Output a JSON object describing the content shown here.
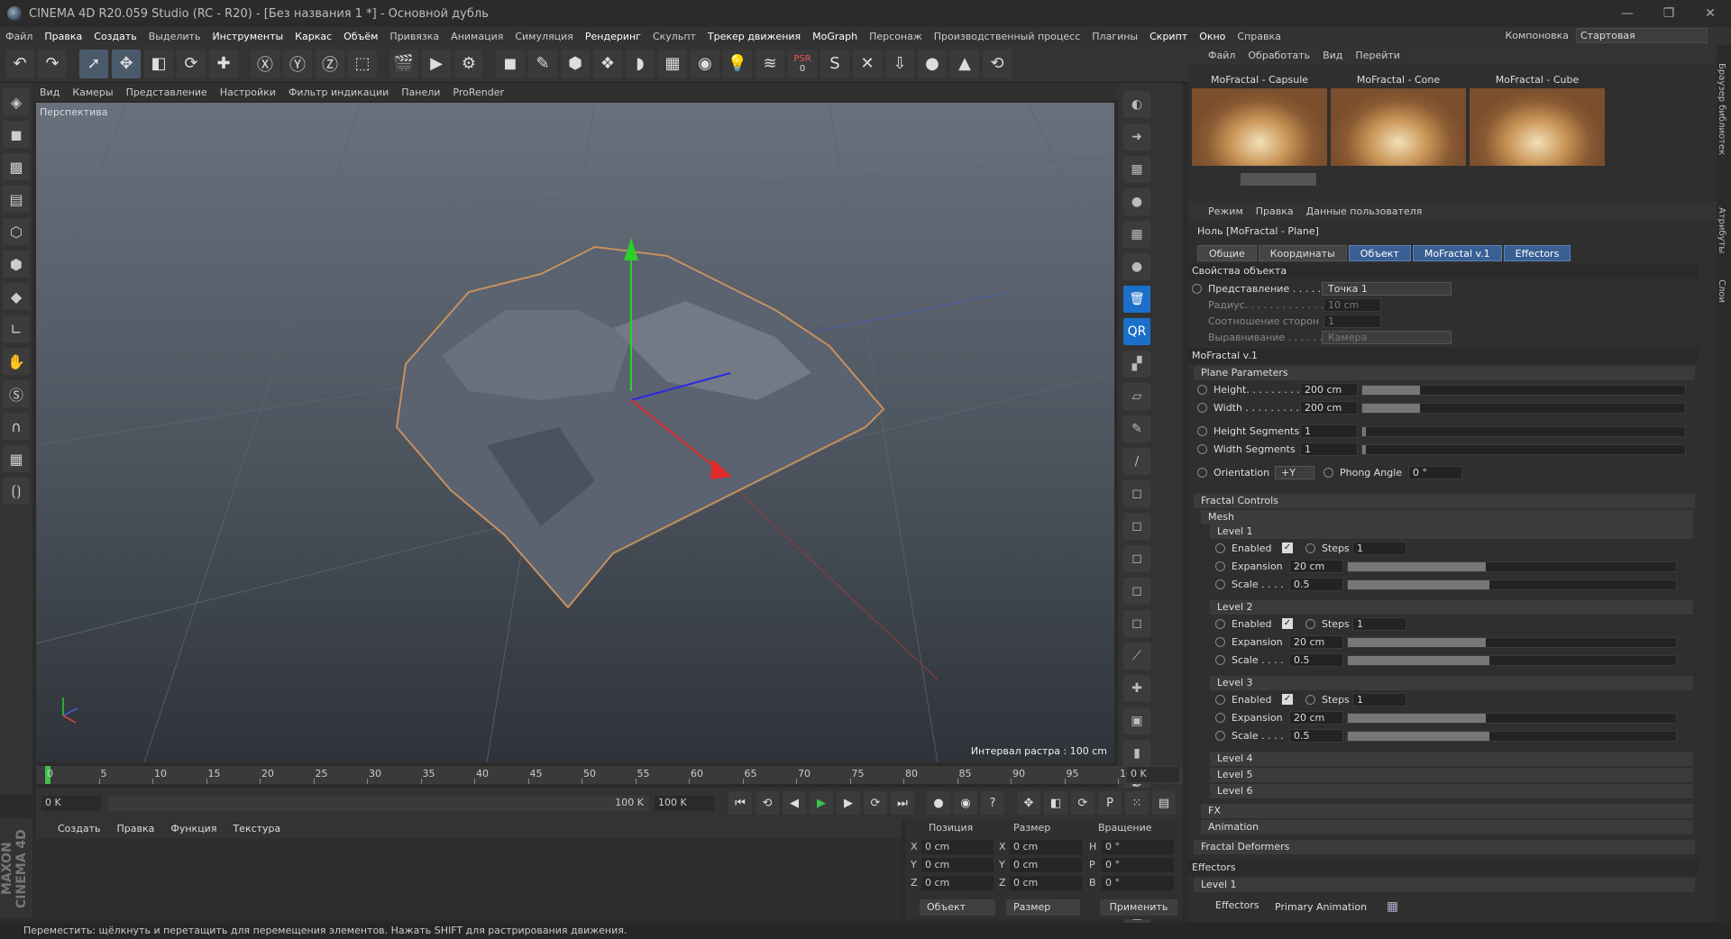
{
  "window": {
    "title": "CINEMA 4D R20.059 Studio (RC - R20) - [Без названия 1 *] - Основной дубль",
    "controls": [
      "—",
      "❐",
      "✕"
    ]
  },
  "menubar": {
    "items": [
      "Файл",
      "Правка",
      "Создать",
      "Выделить",
      "Инструменты",
      "Каркас",
      "Объём",
      "Привязка",
      "Анимация",
      "Симуляция",
      "Рендеринг",
      "Скульпт",
      "Трекер движения",
      "MoGraph",
      "Персонаж",
      "Производственный процесс",
      "Плагины",
      "Скрипт",
      "Окно",
      "Справка"
    ],
    "layout_label": "Компоновка",
    "layout_value": "Стартовая"
  },
  "toolbar": {
    "psr_label": "PSR",
    "psr_value": "0"
  },
  "viewport": {
    "menu": [
      "Вид",
      "Камеры",
      "Представление",
      "Настройки",
      "Фильтр индикации",
      "Панели",
      "ProRender"
    ],
    "label": "Перспектива",
    "grid_info": "Интервал растра : 100 cm"
  },
  "timeline": {
    "ticks": [
      "0",
      "5",
      "10",
      "15",
      "20",
      "25",
      "30",
      "35",
      "40",
      "45",
      "50",
      "55",
      "60",
      "65",
      "70",
      "75",
      "80",
      "85",
      "90",
      "95",
      "100"
    ],
    "current": "0 K",
    "start": "0 K",
    "range_end": "100 K",
    "end": "100 K"
  },
  "material_manager": {
    "menu": [
      "Создать",
      "Правка",
      "Функция",
      "Текстура"
    ]
  },
  "coordinates": {
    "headers": [
      "Позиция",
      "Размер",
      "Вращение"
    ],
    "rows": [
      {
        "a1": "X",
        "v1": "0 cm",
        "a2": "X",
        "v2": "0 cm",
        "a3": "H",
        "v3": "0 °"
      },
      {
        "a1": "Y",
        "v1": "0 cm",
        "a2": "Y",
        "v2": "0 cm",
        "a3": "P",
        "v3": "0 °"
      },
      {
        "a1": "Z",
        "v1": "0 cm",
        "a2": "Z",
        "v2": "0 cm",
        "a3": "B",
        "v3": "0 °"
      }
    ],
    "mode_object": "Объект",
    "mode_size": "Размер",
    "apply": "Применить"
  },
  "status": "Переместить: щёлкнуть и перетащить для перемещения элементов. Нажать SHIFT для растрирования движения.",
  "logo": "MAXON CINEMA 4D",
  "content_browser": {
    "menu": [
      "Файл",
      "Обработать",
      "Вид",
      "Перейти"
    ],
    "presets": [
      "MoFractal - Capsule",
      "MoFractal - Cone",
      "MoFractal - Cube"
    ]
  },
  "attributes": {
    "menu": [
      "Режим",
      "Правка",
      "Данные пользователя"
    ],
    "object_name": "Ноль [MoFractal - Plane]",
    "tabs": [
      "Общие",
      "Координаты",
      "Объект",
      "MoFractal v.1",
      "Effectors"
    ],
    "active_tabs": [
      "Объект",
      "MoFractal v.1",
      "Effectors"
    ],
    "object_props_title": "Свойства объекта",
    "display_label": "Представление . . . . . . .",
    "display_value": "Точка 1",
    "radius_label": "Радиус. . . . . . . . . . . . .",
    "radius_value": "10 cm",
    "aspect_label": "Соотношение сторон",
    "aspect_value": "1",
    "align_label": "Выравнивание . . . . . . .",
    "align_value": "Камера",
    "mofractal_title": "MoFractal v.1",
    "plane_params": "Plane Parameters",
    "height_label": "Height. . . . . . . . .",
    "height_value": "200 cm",
    "width_label": "Width . . . . . . . . .",
    "width_value": "200 cm",
    "hseg_label": "Height Segments",
    "hseg_value": "1",
    "wseg_label": "Width Segments",
    "wseg_value": "1",
    "orientation_label": "Orientation",
    "orientation_value": "+Y",
    "phong_label": "Phong Angle",
    "phong_value": "0 °",
    "fractal_controls": "Fractal Controls",
    "mesh": "Mesh",
    "levels": [
      {
        "name": "Level 1",
        "enabled": "Enabled",
        "steps_label": "Steps",
        "steps": "1",
        "exp_label": "Expansion",
        "exp": "20 cm",
        "scale_label": "Scale . . . .",
        "scale": "0.5"
      },
      {
        "name": "Level 2",
        "enabled": "Enabled",
        "steps_label": "Steps",
        "steps": "1",
        "exp_label": "Expansion",
        "exp": "20 cm",
        "scale_label": "Scale . . . .",
        "scale": "0.5"
      },
      {
        "name": "Level 3",
        "enabled": "Enabled",
        "steps_label": "Steps",
        "steps": "1",
        "exp_label": "Expansion",
        "exp": "20 cm",
        "scale_label": "Scale . . . .",
        "scale": "0.5"
      }
    ],
    "collapsed_levels": [
      "Level 4",
      "Level 5",
      "Level 6"
    ],
    "fx": "FX",
    "animation": "Animation",
    "fractal_deformers": "Fractal Deformers",
    "effectors_title": "Effectors",
    "effectors_level": "Level 1",
    "effectors_label": "Effectors",
    "primary_animation": "Primary Animation"
  },
  "side_tabs": [
    "Браузер библиотек",
    "Атрибуты",
    "Слои"
  ]
}
